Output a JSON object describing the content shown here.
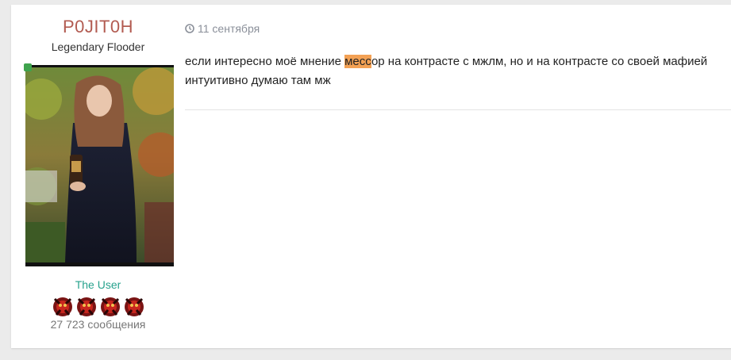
{
  "author": {
    "username": "P0JIT0H",
    "rank_title": "Legendary Flooder",
    "group": "The User",
    "post_count": "27 723 сообщения",
    "avatar_icon": "user-photo",
    "online_color": "#3fa34d",
    "rank_icon_count": 4
  },
  "post": {
    "date": "11 сентября",
    "line1_before": "если интересно моё мнение ",
    "line1_highlight": "месс",
    "line1_after": "ор на контрасте с мжлм, но и на контрасте со своей мафией",
    "line2": "интуитивно думаю там мж",
    "highlight_color": "#f3a154"
  }
}
